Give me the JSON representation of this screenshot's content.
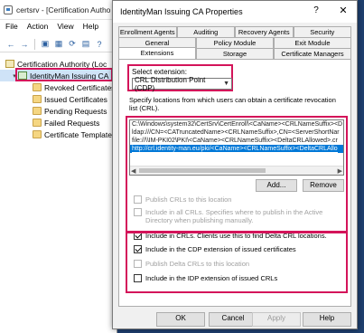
{
  "mmc": {
    "title": "certsrv - [Certification Autho",
    "menu": [
      "File",
      "Action",
      "View",
      "Help"
    ],
    "tree": {
      "root": "Certification Authority (Loc",
      "ca": "IdentityMan Issuing CA",
      "folders": [
        "Revoked Certificates",
        "Issued Certificates",
        "Pending Requests",
        "Failed Requests",
        "Certificate Templates"
      ]
    }
  },
  "dialog": {
    "title": "IdentityMan Issuing CA Properties",
    "help_glyph": "?",
    "close_glyph": "✕",
    "tabs_row1": [
      "Enrollment Agents",
      "Auditing",
      "Recovery Agents",
      "Security"
    ],
    "tabs_row2": [
      "General",
      "Policy Module",
      "Exit Module"
    ],
    "tabs_row3": [
      "Extensions",
      "Storage",
      "Certificate Managers"
    ],
    "active_tab": "Extensions",
    "select_label": "Select extension:",
    "select_value": "CRL Distribution Point (CDP)",
    "description": "Specify locations from which users can obtain a certificate revocation list (CRL).",
    "locations": [
      "C:\\Windows\\system32\\CertSrv\\CertEnroll\\<CaName><CRLNameSuffix><D",
      "ldap:///CN=<CATruncatedName><CRLNameSuffix>,CN=<ServerShortNar",
      "file://\\\\IM-PKI02\\PKI\\<CaName><CRLNameSuffix><DeltaCRLAllowed>.cr",
      "http://crl.identity-man.eu/pki/<CaName><CRLNameSuffix><DeltaCRLAllo"
    ],
    "add_button": "Add...",
    "remove_button": "Remove",
    "checkboxes": [
      {
        "label": "Publish CRLs to this location",
        "checked": false,
        "disabled": true
      },
      {
        "label": "Include in all CRLs. Specifies where to publish in the Active Directory when publishing manually.",
        "checked": false,
        "disabled": true
      },
      {
        "label": "Include in CRLs. Clients use this to find Delta CRL locations.",
        "checked": true,
        "disabled": false
      },
      {
        "label": "Include in the CDP extension of issued certificates",
        "checked": true,
        "disabled": false
      },
      {
        "label": "Publish Delta CRLs to this location",
        "checked": false,
        "disabled": true
      },
      {
        "label": "Include in the IDP extension of issued CRLs",
        "checked": false,
        "disabled": false
      }
    ],
    "footer": {
      "ok": "OK",
      "cancel": "Cancel",
      "apply": "Apply",
      "help": "Help"
    }
  },
  "colors": {
    "highlight": "#d4145a",
    "selection": "#0078d7",
    "desktop": "#1e3f6e"
  }
}
